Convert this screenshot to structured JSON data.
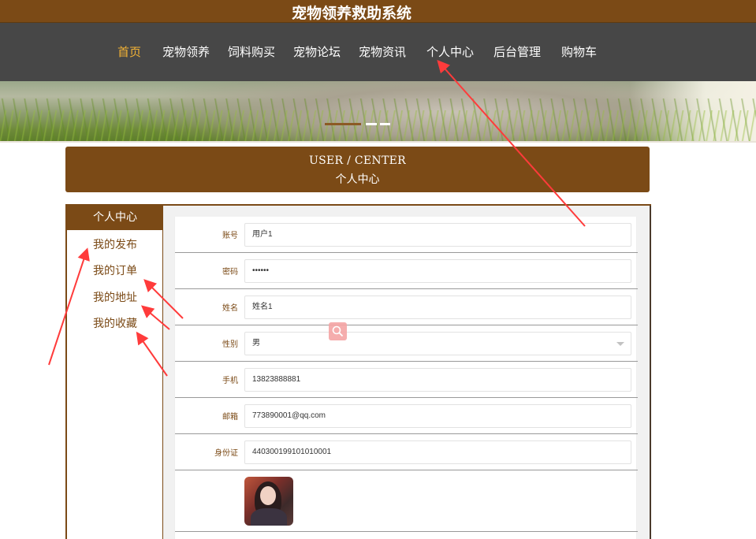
{
  "app": {
    "title": "宠物领养救助系统"
  },
  "nav": {
    "items": [
      {
        "label": "首页",
        "active": true
      },
      {
        "label": "宠物领养"
      },
      {
        "label": "饲料购买"
      },
      {
        "label": "宠物论坛"
      },
      {
        "label": "宠物资讯"
      },
      {
        "label": "个人中心"
      },
      {
        "label": "后台管理"
      },
      {
        "label": "购物车"
      }
    ]
  },
  "header": {
    "en": "USER / CENTER",
    "cn": "个人中心"
  },
  "sidebar": {
    "title": "个人中心",
    "items": [
      {
        "label": "我的发布"
      },
      {
        "label": "我的订单"
      },
      {
        "label": "我的地址"
      },
      {
        "label": "我的收藏"
      }
    ]
  },
  "form": {
    "fields": [
      {
        "label": "账号",
        "value": "用户1"
      },
      {
        "label": "密码",
        "value": "••••••"
      },
      {
        "label": "姓名",
        "value": "姓名1"
      },
      {
        "label": "性别",
        "value": "男"
      },
      {
        "label": "手机",
        "value": "13823888881"
      },
      {
        "label": "邮箱",
        "value": "773890001@qq.com"
      },
      {
        "label": "身份证",
        "value": "440300199101010001"
      }
    ],
    "avatar_icon": "user-avatar-photo"
  },
  "colors": {
    "brand_brown": "#7b4a16",
    "nav_bg": "#474747",
    "nav_active": "#f2b235",
    "annotation_arrow": "#ff3b3b"
  },
  "icons": {
    "floating": "search-icon",
    "select": "chevron-down-icon"
  }
}
